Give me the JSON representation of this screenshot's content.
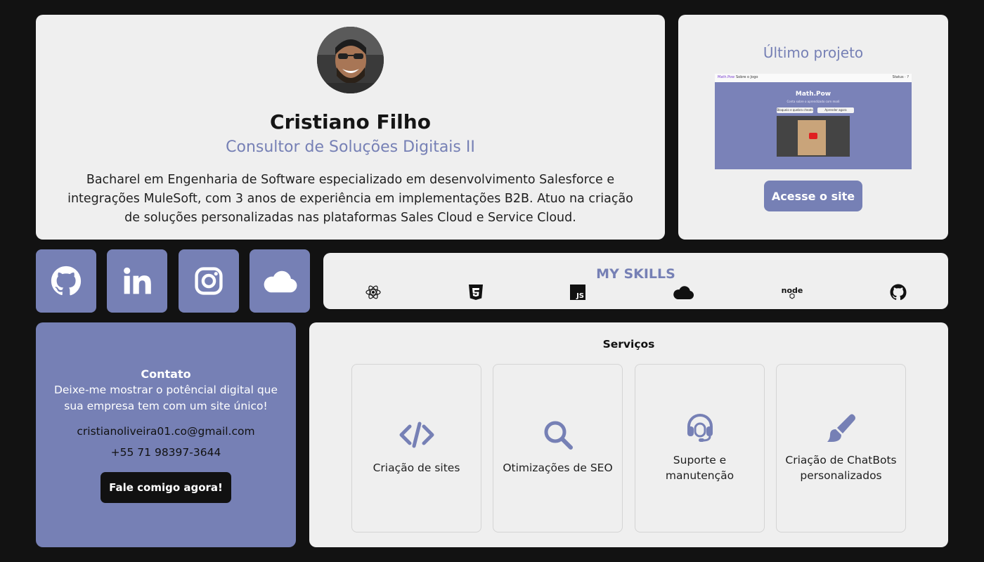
{
  "profile": {
    "name": "Cristiano Filho",
    "role": "Consultor de Soluções Digitais II",
    "bio": "Bacharel em Engenharia de Software especializado em desenvolvimento Salesforce e integrações MuleSoft, com 3 anos de experiência em implementações B2B. Atuo na criação de soluções personalizadas nas plataformas Sales Cloud e Service Cloud."
  },
  "project": {
    "title": "Último projeto",
    "preview": {
      "brand": "Math.Pow",
      "nav": "Sobre o Jogo",
      "nav_right": "Status · ?",
      "headline": "Math.Pow",
      "tagline": "Conta sobre o aprendizado com modi",
      "btn1": "Bloqueio e quebra cheats",
      "btn2": "Aprender agora"
    },
    "button_label": "Acesse o site"
  },
  "socials": [
    {
      "name": "github-icon"
    },
    {
      "name": "linkedin-icon"
    },
    {
      "name": "instagram-icon"
    },
    {
      "name": "cloud-icon"
    }
  ],
  "skills": {
    "title": "MY SKILLS",
    "items": [
      {
        "icon": "react-icon"
      },
      {
        "icon": "css3-icon"
      },
      {
        "icon": "javascript-icon",
        "text": "JS"
      },
      {
        "icon": "salesforce-cloud-icon"
      },
      {
        "icon": "nodejs-icon",
        "text": "node"
      },
      {
        "icon": "github-icon"
      }
    ]
  },
  "contact": {
    "title": "Contato",
    "text": "Deixe-me mostrar o potêncial digital que sua empresa tem com um site único!",
    "email": "cristianoliveira01.co@gmail.com",
    "phone": "+55 71 98397-3644",
    "button_label": "Fale comigo agora!"
  },
  "services": {
    "title": "Serviços",
    "items": [
      {
        "label": "Criação de sites",
        "icon": "code-icon"
      },
      {
        "label": "Otimizações de SEO",
        "icon": "search-icon"
      },
      {
        "label": "Suporte e manutenção",
        "icon": "headset-icon"
      },
      {
        "label": "Criação de ChatBots personalizados",
        "icon": "paintbrush-icon"
      }
    ]
  },
  "colors": {
    "accent": "#7680b5",
    "background": "#121212",
    "card": "#efefef"
  }
}
